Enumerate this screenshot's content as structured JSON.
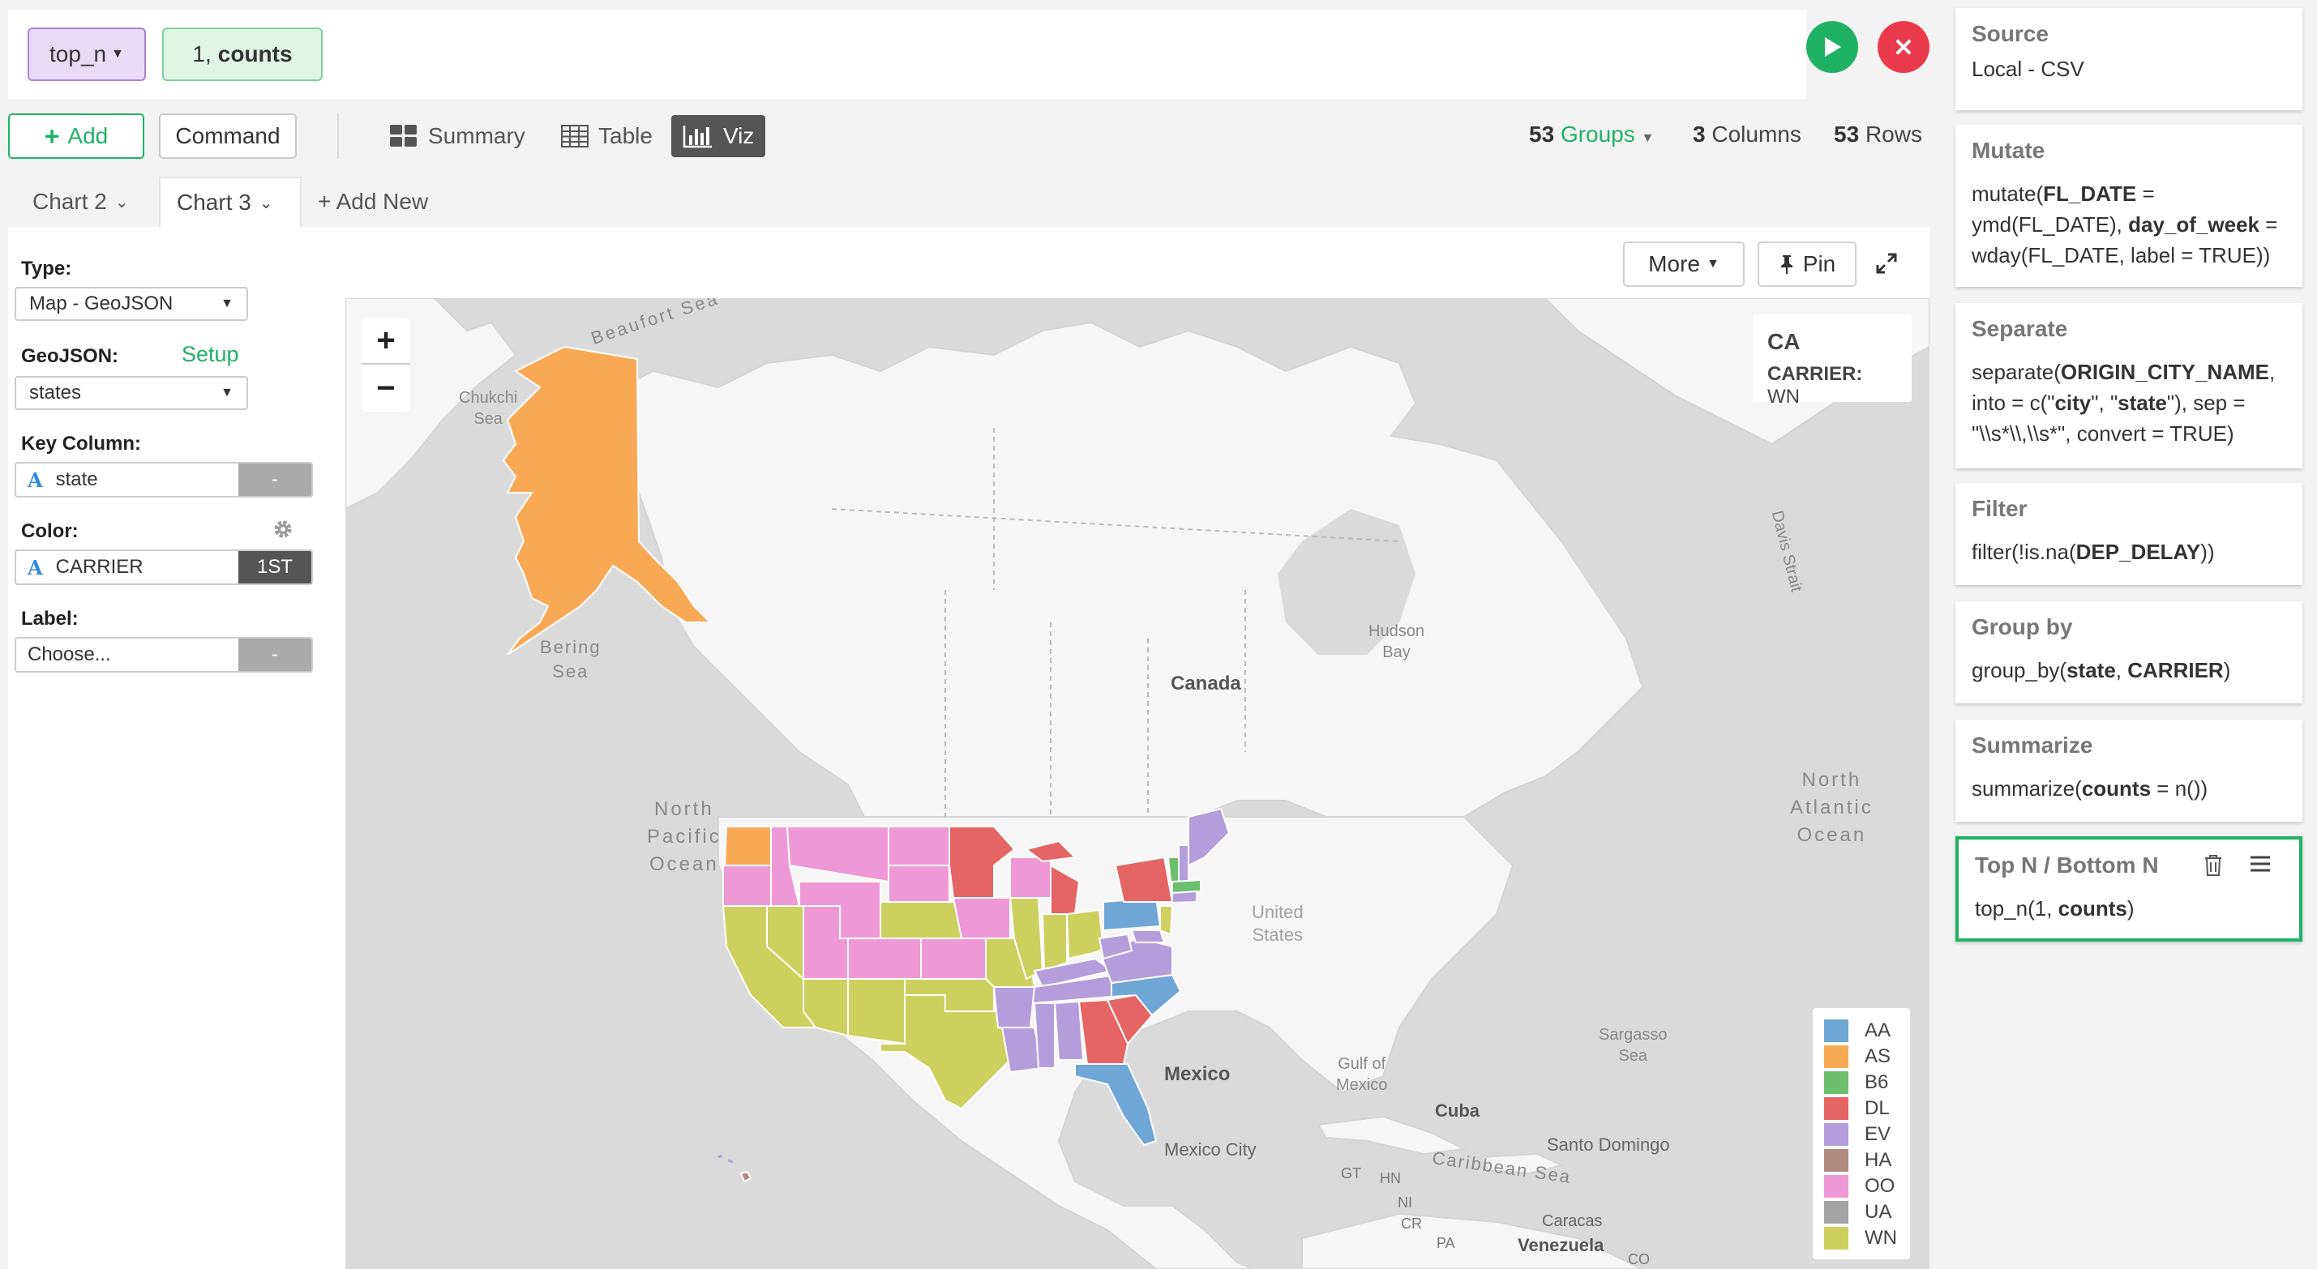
{
  "command": {
    "function_token": "top_n",
    "arg_prefix": "1,",
    "arg_bold": "counts"
  },
  "toolbar": {
    "add_label": "Add",
    "command_label": "Command",
    "tabs": [
      "Summary",
      "Table",
      "Viz"
    ],
    "active_tab": "Viz",
    "groups_count": "53",
    "groups_label": "Groups",
    "columns_count": "3",
    "columns_label": "Columns",
    "rows_count": "53",
    "rows_label": "Rows"
  },
  "chart_tabs": [
    "Chart 2",
    "Chart 3",
    "+ Add New"
  ],
  "active_chart_tab": "Chart 3",
  "settings": {
    "type_label": "Type:",
    "type_value": "Map - GeoJSON",
    "geojson_label": "GeoJSON:",
    "geojson_setup": "Setup",
    "geojson_value": "states",
    "key_column_label": "Key Column:",
    "key_column_value": "state",
    "key_column_side": "-",
    "color_label": "Color:",
    "color_value": "CARRIER",
    "color_side": "1ST",
    "label_label": "Label:",
    "label_value": "Choose...",
    "label_side": "-"
  },
  "chart_actions": {
    "more_label": "More",
    "pin_label": "Pin"
  },
  "map": {
    "zoom_in": "+",
    "zoom_out": "−",
    "tooltip_state": "CA",
    "tooltip_key": "CARRIER:",
    "tooltip_value": "WN",
    "place_labels": {
      "beaufort": "Beaufort Sea",
      "chukchi": [
        "Chukchi",
        "Sea"
      ],
      "bering": [
        "Bering",
        "Sea"
      ],
      "hudson": [
        "Hudson",
        "Bay"
      ],
      "canada": "Canada",
      "davis": "Davis Strait",
      "npacific": [
        "North",
        "Pacific",
        "Ocean"
      ],
      "natlantic": [
        "North",
        "Atlantic",
        "Ocean"
      ],
      "sargasso": [
        "Sargasso",
        "Sea"
      ],
      "gulf": [
        "Gulf of",
        "Mexico"
      ],
      "mexico": "Mexico",
      "mexicocity": "Mexico City",
      "cuba": "Cuba",
      "santodomingo": "Santo Domingo",
      "caribbean": "Caribbean Sea",
      "caracas": "Caracas",
      "venezuela": "Venezuela",
      "us": [
        "United",
        "States"
      ],
      "gt": "GT",
      "hn": "HN",
      "ni": "NI",
      "cr": "CR",
      "pa": "PA",
      "co": "CO"
    }
  },
  "legend": {
    "items": [
      {
        "label": "AA",
        "color": "#6fa6d6"
      },
      {
        "label": "AS",
        "color": "#f9a955"
      },
      {
        "label": "B6",
        "color": "#6cbf6c"
      },
      {
        "label": "DL",
        "color": "#e56464"
      },
      {
        "label": "EV",
        "color": "#b49ddb"
      },
      {
        "label": "HA",
        "color": "#b08b80"
      },
      {
        "label": "OO",
        "color": "#ee99d6"
      },
      {
        "label": "UA",
        "color": "#a3a3a3"
      },
      {
        "label": "WN",
        "color": "#cdd05e"
      }
    ]
  },
  "pipeline": [
    {
      "title": "Source",
      "code": "Local - CSV"
    },
    {
      "title": "Mutate",
      "code": "mutate(FL_DATE = ymd(FL_DATE), day_of_week = wday(FL_DATE, label = TRUE))"
    },
    {
      "title": "Separate",
      "code": "separate(ORIGIN_CITY_NAME, into = c(\"city\", \"state\"), sep = \"\\\\s*\\\\,\\\\s*\", convert = TRUE)"
    },
    {
      "title": "Filter",
      "code": "filter(!is.na(DEP_DELAY))"
    },
    {
      "title": "Group by",
      "code": "group_by(state, CARRIER)"
    },
    {
      "title": "Summarize",
      "code": "summarize(counts = n())"
    },
    {
      "title": "Top N / Bottom N",
      "code": "top_n(1, counts)"
    }
  ]
}
